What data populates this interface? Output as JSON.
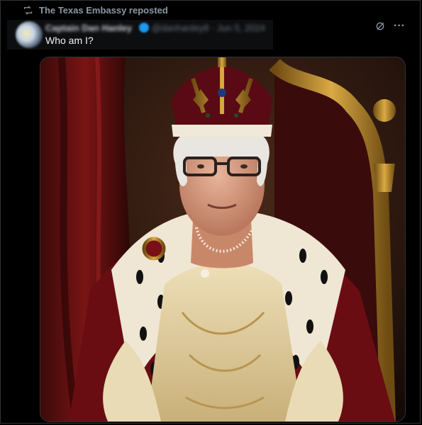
{
  "repost": {
    "label": "The Texas Embassy reposted",
    "icon": "repost-icon"
  },
  "author": {
    "name": "Captain Dan Hanley",
    "handle": "@danhanley8 · Jun 5, 2024",
    "avatar_icon": "avatar",
    "verified_icon": "verified-badge-icon"
  },
  "tweet": {
    "text": "Who am I?"
  },
  "actions": {
    "grok_icon": "grok-icon",
    "more_icon": "more-icon",
    "more_glyph": "···"
  },
  "media": {
    "description_icon": "portrait-image"
  },
  "colors": {
    "background": "#000000",
    "muted": "#8b98a5",
    "accent": "#1d9bf0"
  }
}
